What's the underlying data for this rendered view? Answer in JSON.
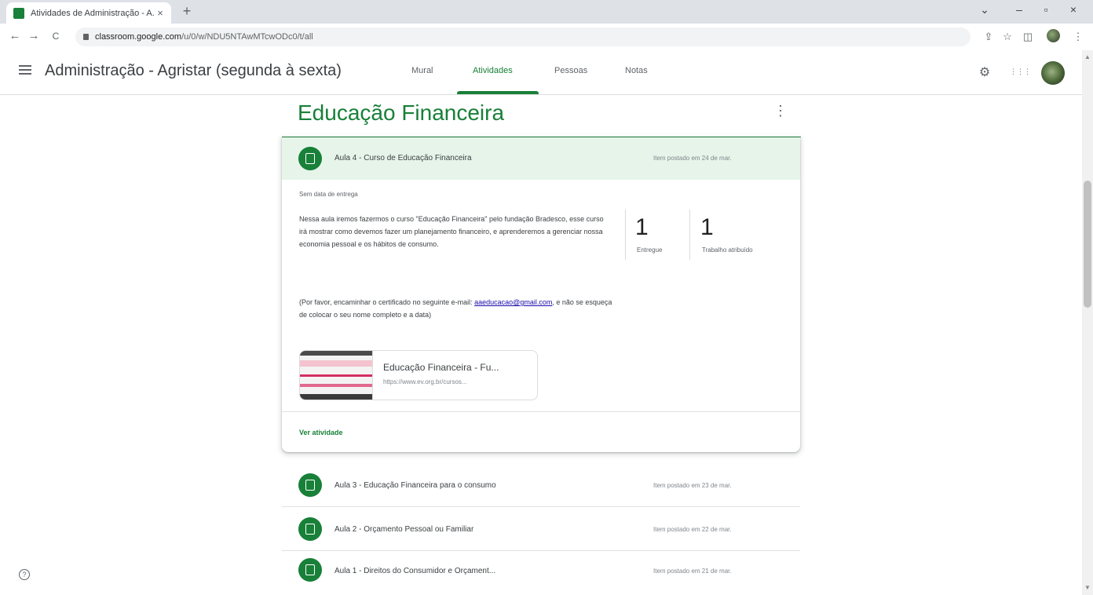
{
  "browser": {
    "tab_title": "Atividades de Administração - A...",
    "tab_close": "×",
    "new_tab": "+",
    "window_controls": [
      "⌄",
      "–",
      "▫",
      "×"
    ],
    "back": "←",
    "forward": "→",
    "reload": "C",
    "url_host": "classroom.google.com",
    "url_path": "/u/0/w/NDU5NTAwMTcwODc0/t/all",
    "toolbar_icons": [
      "⇪",
      "☆",
      "◫",
      "⋮"
    ]
  },
  "header": {
    "class_title": "Administração - Agristar (segunda à sexta)",
    "tabs": [
      {
        "label": "Mural",
        "active": false
      },
      {
        "label": "Atividades",
        "active": true
      },
      {
        "label": "Pessoas",
        "active": false
      },
      {
        "label": "Notas",
        "active": false
      }
    ],
    "icons": [
      "settings-icon",
      "apps-grid-icon",
      "avatar"
    ],
    "settings_glyph": "⚙",
    "apps_glyph": "⋮⋮⋮"
  },
  "topic": {
    "title": "Educação Financeira",
    "menu_glyph": "⋮"
  },
  "expanded": {
    "title": "Aula 4 - Curso de Educação Financeira",
    "date": "Item postado em 24 de mar.",
    "due": "Sem data de entrega",
    "description": "Nessa aula iremos fazermos o curso \"Educação Financeira\" pelo fundação Bradesco, esse curso irá mostrar como devemos fazer um planejamento financeiro, e aprenderemos a gerenciar nossa economia pessoal e os hábitos de consumo.",
    "description2_prefix": "(Por favor, encaminhar o certificado no seguinte e-mail:",
    "email": "aaeducacao@gmail.com",
    "description2_suffix": ", e não se esqueça de colocar o seu nome completo e a data)",
    "stats": [
      {
        "value": "1",
        "label": "Entregue"
      },
      {
        "value": "1",
        "label": "Trabalho atribuído"
      }
    ],
    "attachment": {
      "title": "Educação Financeira - Fu...",
      "url": "https://www.ev.org.br/cursos..."
    },
    "view_link": "Ver atividade"
  },
  "items": [
    {
      "title": "Aula 3 - Educação Financeira para o consumo",
      "date": "Item postado em 23 de mar."
    },
    {
      "title": "Aula 2 - Orçamento Pessoal ou Familiar",
      "date": "Item postado em 22 de mar."
    },
    {
      "title": "Aula 1 - Direitos do Consumidor e Orçament...",
      "date": "Item postado em 21 de mar."
    }
  ],
  "help_glyph": "?",
  "colors": {
    "accent": "#188038",
    "header_bg": "#e6f4ea",
    "link": "#1a0dab"
  }
}
